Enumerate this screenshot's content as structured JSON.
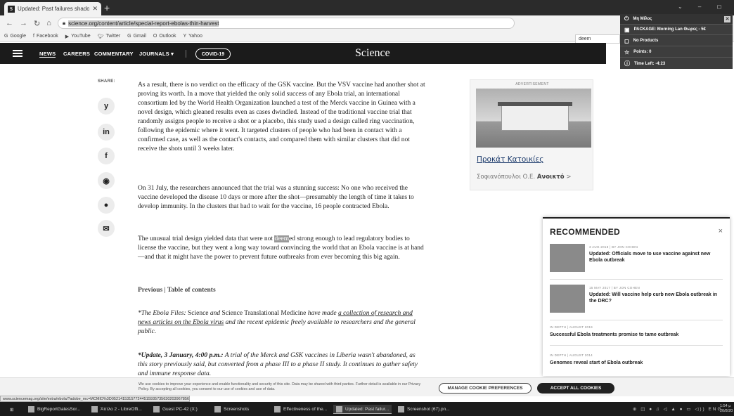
{
  "browser": {
    "tab_title": "Updated: Past failures shadow c",
    "favicon": "S",
    "url": "science.org/content/article/special-report-ebolas-thin-harvest",
    "find_text": "deem",
    "bookmarks": [
      "Google",
      "Facebook",
      "YouTube",
      "Twitter",
      "Gmail",
      "Outlook",
      "Yahoo"
    ]
  },
  "nav": {
    "items": [
      "NEWS",
      "CAREERS",
      "COMMENTARY",
      "JOURNALS ▾"
    ],
    "covid": "COVID-19",
    "brand": "Science"
  },
  "share": {
    "label": "SHARE:",
    "icons": [
      "y",
      "in",
      "f",
      "◉",
      "●",
      "✉"
    ]
  },
  "article": {
    "p1": "As a result, there is no verdict on the efficacy of the GSK vaccine. But the VSV vaccine had another shot at proving its worth. In a move that yielded the only solid success of any Ebola trial, an international consortium led by the World Health Organization launched a test of the Merck vaccine in Guinea with a novel design, which gleaned results even as cases dwindled. Instead of the traditional vaccine trial that randomly assigns people to receive a shot or a placebo, this study used a design called ring vaccination, following the epidemic where it went. It targeted clusters of people who had been in contact with a confirmed case, as well as the contact's contacts, and compared them with similar clusters that did not receive the shots until 3 weeks later.",
    "p2": "On 31 July, the researchers announced that the trial was a stunning success: No one who received the vaccine developed the disease 10 days or more after the shot—presumably the length of time it takes to develop immunity. In the clusters that had to wait for the vaccine, 16 people contracted Ebola.",
    "p3_pre": "The unusual trial design yielded data that were not ",
    "p3_hl": "deem",
    "p3_post": "ed strong enough to lead regulatory bodies to license the vaccine, but they went a long way toward convincing the world that an Ebola vaccine is at hand—and that it might have the power to prevent future outbreaks from ever becoming this big again.",
    "prevnav": "Previous | Table of contents",
    "note1_a": "*The Ebola Files:",
    "note1_b": " Science ",
    "note1_c": "and",
    "note1_d": " Science Translational Medicine ",
    "note1_e": "have made ",
    "note1_link": "a collection of research and news articles on the Ebola virus",
    "note1_f": " and the recent epidemic freely available to researchers and the general public.",
    "note2_a": "*Update, 3 January, 4:00 p.m.:",
    "note2_b": " A trial of the Merck and GSK vaccines in Liberia wasn't abandoned, as this story previously said, but converted from a phase III to a phase II study. It continues to gather safety and immune response data."
  },
  "ad": {
    "label": "ADVERTISEMENT",
    "title": "Προκάτ Κατοικίες",
    "sub_a": "Σοφιανόπουλοι Ο.Ε. ",
    "sub_b": "Ανοικτό",
    "sub_c": " >"
  },
  "extension": {
    "user": "Mη Mίλος",
    "package": "PACKAGE: Morning Lan Θωρες - 5€",
    "products": "No Products",
    "points": "Points: 0",
    "time": "Time Left: -4:23"
  },
  "recommended": {
    "title": "RECOMMENDED",
    "close": "×",
    "items": [
      {
        "meta": "3 AUG 2018 | BY JON COHEN",
        "headline": "Updated: Officials move to use vaccine against new Ebola outbreak"
      },
      {
        "meta": "15 MAY 2017 | BY JON COHEN",
        "headline": "Updated: Will vaccine help curb new Ebola outbreak in the DRC?"
      },
      {
        "meta": "IN DEPTH | AUGUST 2019",
        "headline": "Successful Ebola treatments promise to tame outbreak"
      },
      {
        "meta": "IN DEPTH | AUGUST 2014",
        "headline": "Genomes reveal start of Ebola outbreak"
      }
    ]
  },
  "cookie": {
    "text": "We use cookies to improve your experience and enable functionality and security of this site. Data may be shared with third parties. Further detail is available in our Privacy Policy. By accepting all cookies, you consent to our use of cookies and use of data.",
    "manage": "MANAGE COOKIE PREFERENCES",
    "accept": "ACCEPT ALL COOKIES"
  },
  "status_url": "www.sciencemag.org/site/extra/ebola/?adobe_mc=MCMID%3D05214153157724451593573563020396785602%7CM...",
  "taskbar": {
    "items": [
      "BigReportGatesSor...",
      "Άτιτλο 2 - LibreOffi...",
      "Guest PC-42 (X:)",
      "Screenshots",
      "Effectiveness of the...",
      "Updated: Past failur...",
      "Screenshot (67).pn..."
    ],
    "tray": "⊕ ◫ ● ♫ ◁ ▲ ● ▭ ◁)) ENG",
    "time": "1:54 μ",
    "date": "20/8/20"
  }
}
